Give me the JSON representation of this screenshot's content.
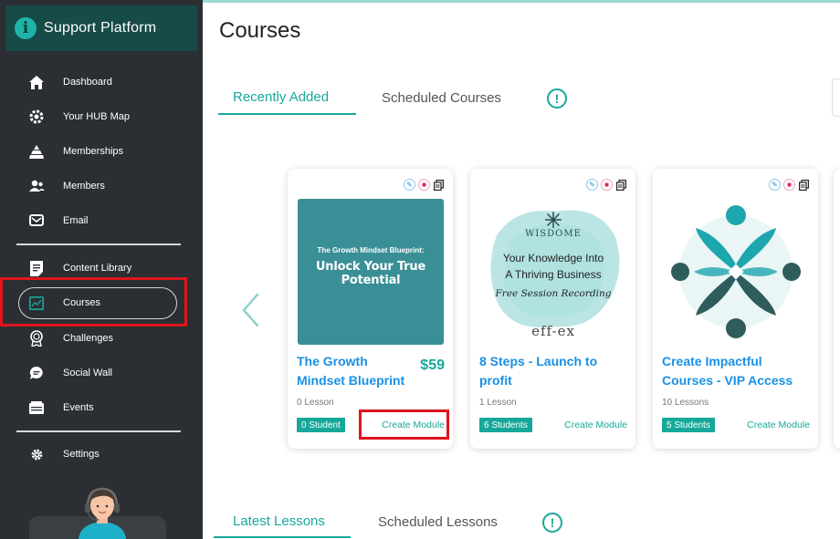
{
  "brand": {
    "name": "Support Platform",
    "logo_letter": "i",
    "logo_color": "#1db4a8"
  },
  "sidebar": {
    "items": [
      {
        "label": "Dashboard",
        "icon": "home-icon"
      },
      {
        "label": "Your HUB Map",
        "icon": "gear-icon"
      },
      {
        "label": "Memberships",
        "icon": "pyramid-icon"
      },
      {
        "label": "Members",
        "icon": "users-icon"
      },
      {
        "label": "Email",
        "icon": "email-icon"
      },
      {
        "label": "Content Library",
        "icon": "document-icon"
      },
      {
        "label": "Courses",
        "icon": "chart-icon",
        "active": true
      },
      {
        "label": "Challenges",
        "icon": "medal-icon"
      },
      {
        "label": "Social Wall",
        "icon": "chat-icon"
      },
      {
        "label": "Events",
        "icon": "calendar-icon"
      },
      {
        "label": "Settings",
        "icon": "settings-icon"
      }
    ]
  },
  "page": {
    "title": "Courses"
  },
  "course_tabs": [
    {
      "label": "Recently Added",
      "active": true
    },
    {
      "label": "Scheduled Courses",
      "active": false
    }
  ],
  "lesson_tabs": [
    {
      "label": "Latest Lessons",
      "active": true
    },
    {
      "label": "Scheduled Lessons",
      "active": false
    }
  ],
  "info_glyph": "!",
  "courses": [
    {
      "title": "The Growth Mindset Blueprint",
      "price": "$59",
      "lessons": "0 Lesson",
      "students": "0 Student",
      "create": "Create Module",
      "thumb_small": "The Growth Mindset Blueprint:",
      "thumb_big": "Unlock Your True Potential",
      "thumb_color": "#3a8f96"
    },
    {
      "title": "8 Steps - Launch to profit",
      "price": "",
      "lessons": "1 Lesson",
      "students": "6 Students",
      "create": "Create Module",
      "thumb_brand": "WISDOME",
      "thumb_line1": "Your Knowledge Into",
      "thumb_line2": "A Thriving Business",
      "thumb_script": "Free Session Recording",
      "thumb_footer": "eff-ex"
    },
    {
      "title": "Create Impactful Courses - VIP Access",
      "price": "",
      "lessons": "10 Lessons",
      "students": "5 Students",
      "create": "Create Module"
    }
  ],
  "colors": {
    "accent": "#16a89a",
    "link": "#1a90e5",
    "sidebar": "#2b2f33",
    "highlight": "#e0141c"
  }
}
